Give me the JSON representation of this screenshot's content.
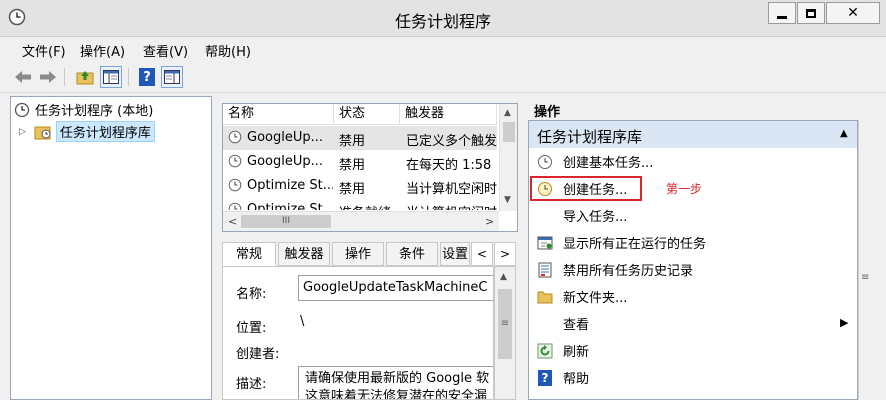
{
  "window": {
    "title": "任务计划程序",
    "minimize_glyph": "▁",
    "maximize_glyph": "□",
    "close_glyph": "✕"
  },
  "menu": [
    "文件(F)",
    "操作(A)",
    "查看(V)",
    "帮助(H)"
  ],
  "toolbar": {
    "icons": [
      "back-arrow-icon",
      "forward-arrow-icon",
      "folder-up-icon",
      "show-hide-pane-icon",
      "help-icon",
      "action-pane-icon"
    ],
    "help_glyph": "?"
  },
  "tree": {
    "root_label": "任务计划程序 (本地)",
    "child_label": "任务计划程序库",
    "expander": "▷"
  },
  "task_list": {
    "columns": [
      "名称",
      "状态",
      "触发器"
    ],
    "rows": [
      {
        "name": "GoogleUp...",
        "status": "禁用",
        "trigger": "已定义多个触发"
      },
      {
        "name": "GoogleUp...",
        "status": "禁用",
        "trigger": "在每天的 1:58"
      },
      {
        "name": "Optimize St...",
        "status": "禁用",
        "trigger": "当计算机空闲时"
      },
      {
        "name": "Optimize St...",
        "status": "准备就绪",
        "trigger": "当计算机空闲时"
      }
    ],
    "hscroll_thumb": "III"
  },
  "details": {
    "tabs": [
      "常规",
      "触发器",
      "操作",
      "条件",
      "设置"
    ],
    "labels": {
      "name": "名称:",
      "location": "位置:",
      "author": "创建者:",
      "description": "描述:"
    },
    "values": {
      "name": "GoogleUpdateTaskMachineC",
      "location": "\\",
      "author": "",
      "description_line1": "请确保使用最新版的 Google 软",
      "description_line2": "这意味着无法修复潜在的安全漏"
    }
  },
  "actions_pane": {
    "header": "操作",
    "section_title": "任务计划程序库",
    "items": [
      {
        "label": "创建基本任务...",
        "icon": "clock-wizard-icon"
      },
      {
        "label": "创建任务...",
        "icon": "create-task-icon"
      },
      {
        "label": "导入任务...",
        "icon": ""
      },
      {
        "label": "显示所有正在运行的任务",
        "icon": "running-tasks-icon"
      },
      {
        "label": "禁用所有任务历史记录",
        "icon": "history-icon"
      },
      {
        "label": "新文件夹...",
        "icon": "folder-icon"
      },
      {
        "label": "查看",
        "icon": ""
      },
      {
        "label": "刷新",
        "icon": "refresh-icon"
      },
      {
        "label": "帮助",
        "icon": "help-icon"
      }
    ],
    "annotation": "第一步"
  },
  "colors": {
    "selection": "#cce8ff",
    "section_header": "#dbe6f4",
    "annotation_red": "#d9262c",
    "help_blue": "#1f58b8"
  }
}
